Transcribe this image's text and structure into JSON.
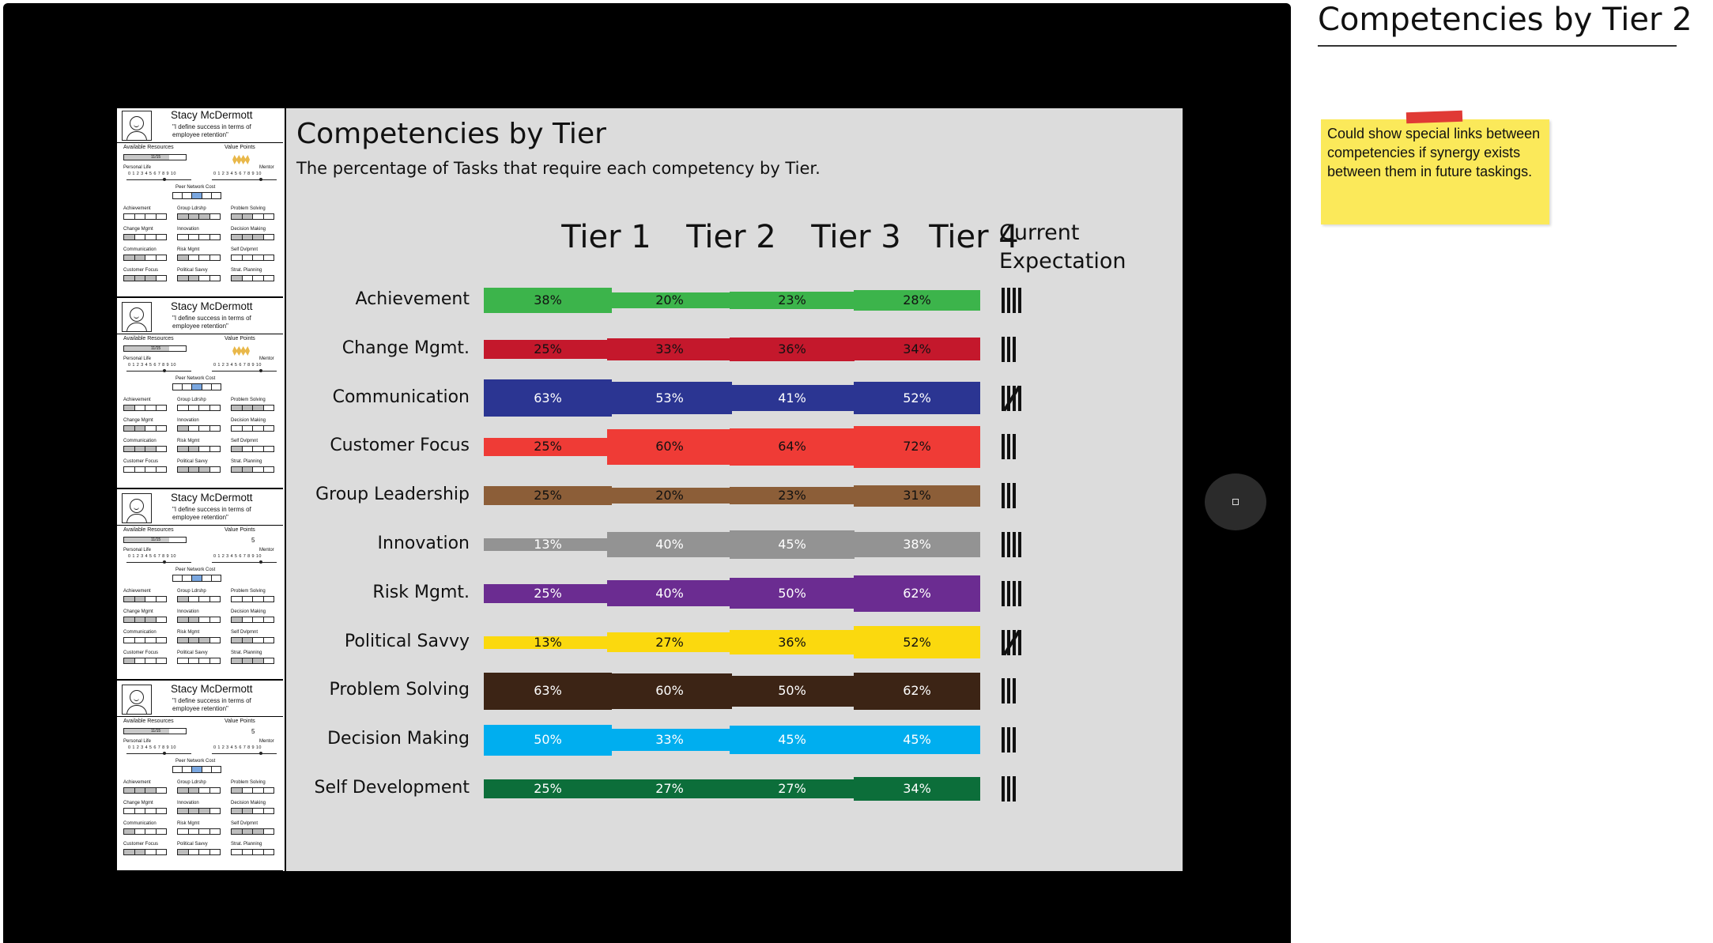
{
  "side": {
    "title": "Competencies by Tier 2",
    "note": "Could show special links between competencies if synergy exists between them in future taskings."
  },
  "chart": {
    "title": "Competencies by Tier",
    "subtitle": "The percentage of Tasks that require each competency by Tier.",
    "tiers": [
      "Tier 1",
      "Tier 2",
      "Tier 3",
      "Tier 4"
    ],
    "current_expectation_label": "Current Expectation"
  },
  "chart_data": {
    "type": "table",
    "title": "Competencies by Tier",
    "columns": [
      "Tier 1",
      "Tier 2",
      "Tier 3",
      "Tier 4",
      "Current Expectation"
    ],
    "rows": [
      {
        "name": "Achievement",
        "color": "#3cb44b",
        "values": [
          38,
          20,
          23,
          28
        ],
        "labels": [
          "38%",
          "20%",
          "23%",
          "28%"
        ],
        "expectation": 4
      },
      {
        "name": "Change Mgmt.",
        "color": "#c4182c",
        "values": [
          25,
          33,
          36,
          34
        ],
        "labels": [
          "25%",
          "33%",
          "36%",
          "34%"
        ],
        "expectation": 3
      },
      {
        "name": "Communication",
        "color": "#2b3592",
        "values": [
          63,
          53,
          41,
          52
        ],
        "labels": [
          "63%",
          "53%",
          "41%",
          "52%"
        ],
        "expectation": 5
      },
      {
        "name": "Customer Focus",
        "color": "#ef3b36",
        "values": [
          25,
          60,
          64,
          72
        ],
        "labels": [
          "25%",
          "60%",
          "64%",
          "72%"
        ],
        "expectation": 3
      },
      {
        "name": "Group Leadership",
        "color": "#8c5e38",
        "values": [
          25,
          20,
          23,
          31
        ],
        "labels": [
          "25%",
          "20%",
          "23%",
          "31%"
        ],
        "expectation": 3
      },
      {
        "name": "Innovation",
        "color": "#939393",
        "values": [
          13,
          40,
          45,
          38
        ],
        "labels": [
          "13%",
          "40%",
          "45%",
          "38%"
        ],
        "expectation": 4
      },
      {
        "name": "Risk Mgmt.",
        "color": "#6b2c91",
        "values": [
          25,
          40,
          50,
          62
        ],
        "labels": [
          "25%",
          "40%",
          "50%",
          "62%"
        ],
        "expectation": 4
      },
      {
        "name": "Political Savvy",
        "color": "#fbd90e",
        "values": [
          13,
          27,
          36,
          52
        ],
        "labels": [
          "13%",
          "27%",
          "36%",
          "52%"
        ],
        "expectation": 5
      },
      {
        "name": "Problem Solving",
        "color": "#3c2415",
        "values": [
          63,
          60,
          50,
          62
        ],
        "labels": [
          "63%",
          "60%",
          "50%",
          "62%"
        ],
        "expectation": 3
      },
      {
        "name": "Decision Making",
        "color": "#00aeef",
        "values": [
          50,
          33,
          45,
          45
        ],
        "labels": [
          "50%",
          "33%",
          "45%",
          "45%"
        ],
        "expectation": 3
      },
      {
        "name": "Self Development",
        "color": "#0c6e3a",
        "values": [
          25,
          27,
          27,
          34
        ],
        "labels": [
          "25%",
          "27%",
          "27%",
          "34%"
        ],
        "expectation": 3
      }
    ]
  },
  "profile": {
    "name": "Stacy McDermott",
    "quote": "\"I define success in terms of employee retention\"",
    "available_resources": "Available Resources",
    "resources_value": "11/15",
    "value_points": "Value Points",
    "value_points_number": "5",
    "personal_life": "Personal Life",
    "mentor": "Mentor",
    "scale": "0 1 2 3 4 5 6 7 8 9 10",
    "peer_network_cost": "Peer Network Cost",
    "skills": [
      "Achievement",
      "Group Ldrshp",
      "Problem Solving",
      "Change Mgmt",
      "Innovation",
      "Decision Making",
      "Communication",
      "Risk Mgmt",
      "Self Dvlpmnt",
      "Customer Focus",
      "Political Savvy",
      "Strat. Planning"
    ]
  }
}
